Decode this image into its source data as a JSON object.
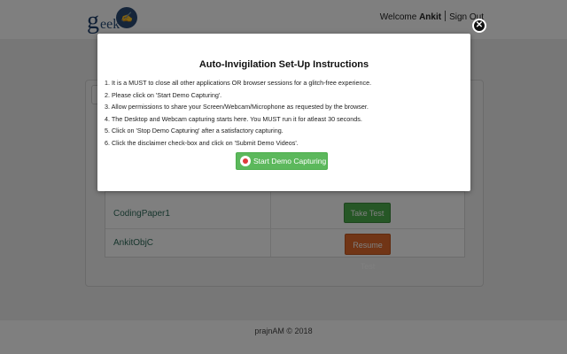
{
  "header": {
    "logo_letter": "g",
    "logo_rest": "eek",
    "user_greeting": "Welcome",
    "user_name": "Ankit",
    "signout_label": "Sign Out"
  },
  "tests": [
    {
      "name": "CodingPaper1",
      "action_label": "Take Test"
    },
    {
      "name": "AnkitObjC",
      "action_label": "Resume Test"
    }
  ],
  "footer": {
    "text": "prajnAM © 2018"
  },
  "modal": {
    "title": "Auto-Invigilation Set-Up Instructions",
    "instructions": [
      "1. It is a MUST to close all other applications OR browser sessions for a glitch-free experience.",
      "2. Please click on 'Start Demo Capturing'.",
      "3. Allow permissions to share your Screen/Webcam/Microphone as requested by the browser.",
      "4. The Desktop and Webcam capturing starts here. You MUST run it for atleast 30 seconds.",
      "5. Click on 'Stop Demo Capturing' after a satisfactory capturing.",
      "6. Click the disclaimer check-box and click on 'Submit Demo Videos'."
    ],
    "capture_button_label": "Start Demo Capturing",
    "close_symbol": "✕"
  },
  "colors": {
    "take_test": "#4cae4c",
    "resume_test": "#e26a2c",
    "capture_button": "#5cb85c"
  },
  "icons": {
    "logo": "geek-logo-icon",
    "capture": "webcam-record-icon",
    "close": "close-icon"
  }
}
